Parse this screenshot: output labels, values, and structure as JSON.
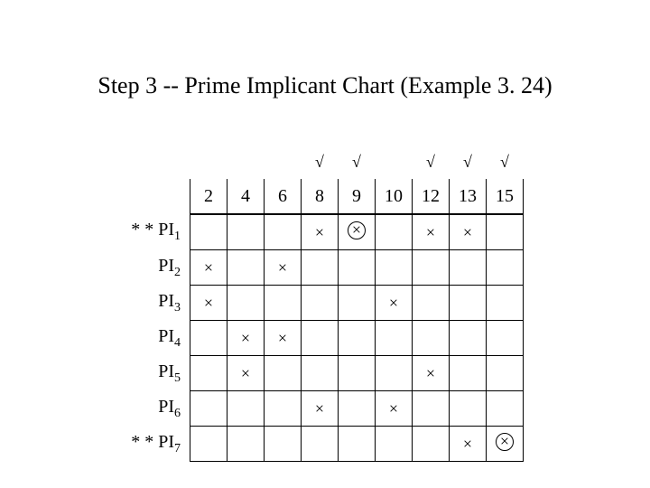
{
  "title": "Step 3 -- Prime Implicant Chart (Example 3. 24)",
  "columns": [
    "2",
    "4",
    "6",
    "8",
    "9",
    "10",
    "12",
    "13",
    "15"
  ],
  "check_marks": {
    "8": "√",
    "9": "√",
    "12": "√",
    "13": "√",
    "15": "√"
  },
  "rows": [
    {
      "prefix": "* * ",
      "name": "PI",
      "sub": "1",
      "cells": {
        "8": "×",
        "9": "⊗",
        "12": "×",
        "13": "×"
      }
    },
    {
      "prefix": "",
      "name": "PI",
      "sub": "2",
      "cells": {
        "2": "×",
        "6": "×"
      }
    },
    {
      "prefix": "",
      "name": "PI",
      "sub": "3",
      "cells": {
        "2": "×",
        "10": "×"
      }
    },
    {
      "prefix": "",
      "name": "PI",
      "sub": "4",
      "cells": {
        "4": "×",
        "6": "×"
      }
    },
    {
      "prefix": "",
      "name": "PI",
      "sub": "5",
      "cells": {
        "4": "×",
        "12": "×"
      }
    },
    {
      "prefix": "",
      "name": "PI",
      "sub": "6",
      "cells": {
        "8": "×",
        "10": "×"
      }
    },
    {
      "prefix": "* * ",
      "name": "PI",
      "sub": "7",
      "cells": {
        "13": "×",
        "15": "⊗"
      }
    }
  ],
  "chart_data": {
    "type": "table",
    "title": "Prime Implicant Chart (Example 3.24)",
    "minterms": [
      2,
      4,
      6,
      8,
      9,
      10,
      12,
      13,
      15
    ],
    "covered_minterms": [
      8,
      9,
      12,
      13,
      15
    ],
    "prime_implicants": [
      {
        "id": "PI1",
        "essential": true,
        "covers": [
          8,
          9,
          12,
          13
        ],
        "distinguished": [
          9
        ]
      },
      {
        "id": "PI2",
        "essential": false,
        "covers": [
          2,
          6
        ]
      },
      {
        "id": "PI3",
        "essential": false,
        "covers": [
          2,
          10
        ]
      },
      {
        "id": "PI4",
        "essential": false,
        "covers": [
          4,
          6
        ]
      },
      {
        "id": "PI5",
        "essential": false,
        "covers": [
          4,
          12
        ]
      },
      {
        "id": "PI6",
        "essential": false,
        "covers": [
          8,
          10
        ]
      },
      {
        "id": "PI7",
        "essential": true,
        "covers": [
          13,
          15
        ],
        "distinguished": [
          15
        ]
      }
    ]
  }
}
